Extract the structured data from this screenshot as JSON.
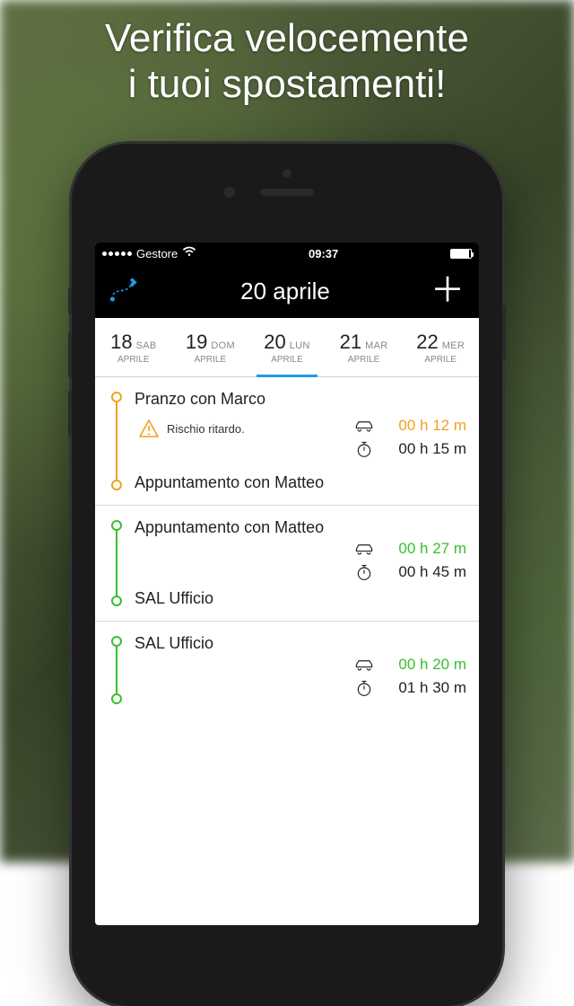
{
  "tagline_line1": "Verifica velocemente",
  "tagline_line2": "i tuoi spostamenti!",
  "statusbar": {
    "carrier": "Gestore",
    "time": "09:37"
  },
  "header": {
    "title": "20 aprile"
  },
  "dates": [
    {
      "num": "18",
      "dow": "SAB",
      "mon": "APRILE",
      "selected": false
    },
    {
      "num": "19",
      "dow": "DOM",
      "mon": "APRILE",
      "selected": false
    },
    {
      "num": "20",
      "dow": "LUN",
      "mon": "APRILE",
      "selected": true
    },
    {
      "num": "21",
      "dow": "MAR",
      "mon": "APRILE",
      "selected": false
    },
    {
      "num": "22",
      "dow": "MER",
      "mon": "APRILE",
      "selected": false
    }
  ],
  "items": [
    {
      "color": "orange",
      "from": "Pranzo con Marco",
      "to": "Appuntamento con Matteo",
      "warning": "Rischio ritardo.",
      "travel": "00 h 12 m",
      "avail": "00 h 15 m"
    },
    {
      "color": "green",
      "from": "Appuntamento con Matteo",
      "to": "SAL Ufficio",
      "warning": null,
      "travel": "00 h 27 m",
      "avail": "00 h 45 m"
    },
    {
      "color": "green",
      "from": "SAL Ufficio",
      "to": "",
      "warning": null,
      "travel": "00 h 20 m",
      "avail": "01 h 30 m"
    }
  ]
}
